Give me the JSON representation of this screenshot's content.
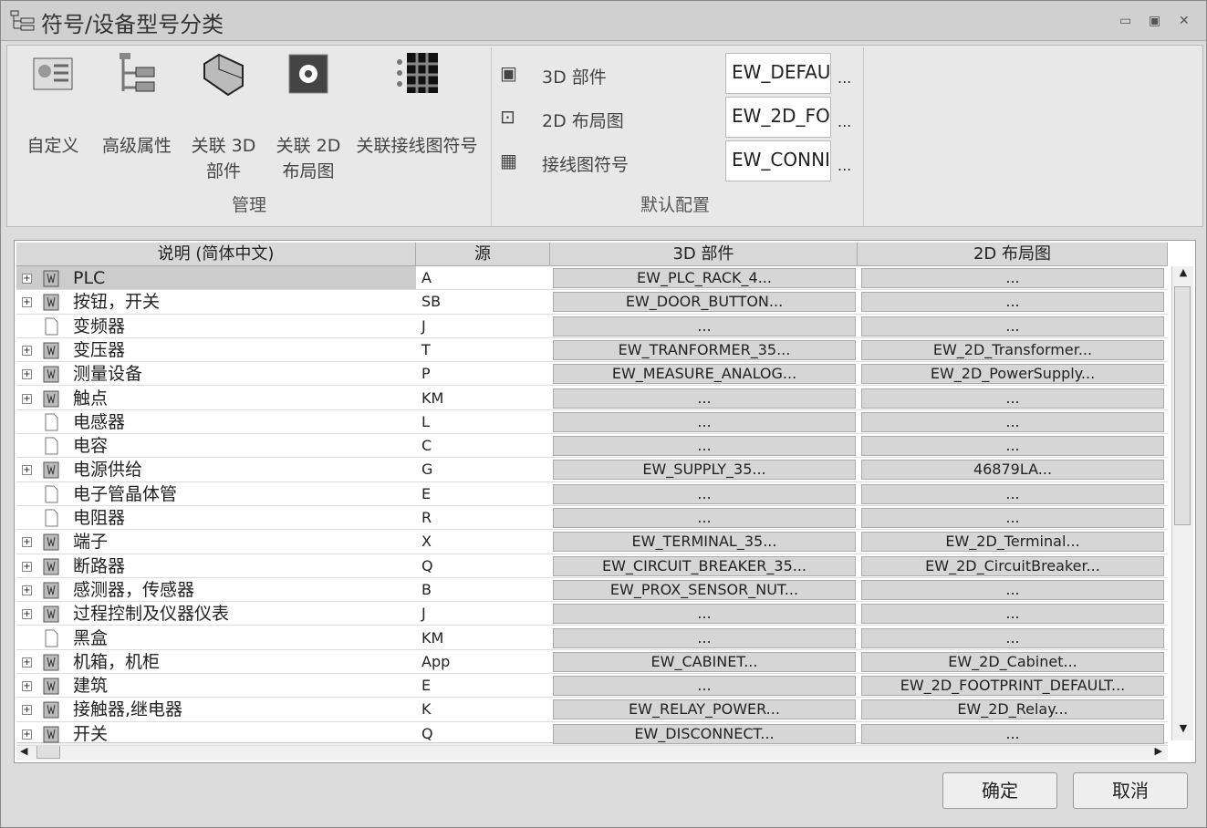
{
  "window": {
    "title": "符号/设备型号分类",
    "minimize": "▭",
    "restore": "▣",
    "close": "✕"
  },
  "ribbon": {
    "manage": {
      "label": "管理",
      "buttons": [
        {
          "label": "自定义",
          "icon": "user-card-icon"
        },
        {
          "label": "高级属性",
          "icon": "tree-icon"
        },
        {
          "label": "关联 3D 部件",
          "icon": "3d-part-icon"
        },
        {
          "label": "关联 2D 布局图",
          "icon": "2d-layout-icon"
        },
        {
          "label": "关联接线图符号",
          "icon": "wiring-symbol-icon"
        }
      ]
    },
    "defaults": {
      "label": "默认配置",
      "items": [
        {
          "label": "3D 部件",
          "value": "EW_DEFAU",
          "more": "..."
        },
        {
          "label": "2D 布局图",
          "value": "EW_2D_FO",
          "more": "..."
        },
        {
          "label": "接线图符号",
          "value": "EW_CONNI",
          "more": "..."
        }
      ]
    }
  },
  "table": {
    "headers": [
      "说明 (简体中文)",
      "源",
      "3D 部件",
      "2D 布局图"
    ],
    "rows": [
      {
        "desc": "PLC",
        "src": "A",
        "p3d": "EW_PLC_RACK_4...",
        "p2d": "...",
        "exp": true
      },
      {
        "desc": "按钮，开关",
        "src": "SB",
        "p3d": "EW_DOOR_BUTTON...",
        "p2d": "...",
        "exp": true
      },
      {
        "desc": "变频器",
        "src": "J",
        "p3d": "...",
        "p2d": "...",
        "exp": false
      },
      {
        "desc": "变压器",
        "src": "T",
        "p3d": "EW_TRANFORMER_35...",
        "p2d": "EW_2D_Transformer...",
        "exp": true
      },
      {
        "desc": "测量设备",
        "src": "P",
        "p3d": "EW_MEASURE_ANALOG...",
        "p2d": "EW_2D_PowerSupply...",
        "exp": true
      },
      {
        "desc": "触点",
        "src": "KM",
        "p3d": "...",
        "p2d": "...",
        "exp": true
      },
      {
        "desc": "电感器",
        "src": "L",
        "p3d": "...",
        "p2d": "...",
        "exp": false
      },
      {
        "desc": "电容",
        "src": "C",
        "p3d": "...",
        "p2d": "...",
        "exp": false
      },
      {
        "desc": "电源供给",
        "src": "G",
        "p3d": "EW_SUPPLY_35...",
        "p2d": "46879LA...",
        "exp": true
      },
      {
        "desc": "电子管晶体管",
        "src": "E",
        "p3d": "...",
        "p2d": "...",
        "exp": false
      },
      {
        "desc": "电阻器",
        "src": "R",
        "p3d": "...",
        "p2d": "...",
        "exp": false
      },
      {
        "desc": "端子",
        "src": "X",
        "p3d": "EW_TERMINAL_35...",
        "p2d": "EW_2D_Terminal...",
        "exp": true
      },
      {
        "desc": "断路器",
        "src": "Q",
        "p3d": "EW_CIRCUIT_BREAKER_35...",
        "p2d": "EW_2D_CircuitBreaker...",
        "exp": true
      },
      {
        "desc": "感测器，传感器",
        "src": "B",
        "p3d": "EW_PROX_SENSOR_NUT...",
        "p2d": "...",
        "exp": true
      },
      {
        "desc": "过程控制及仪器仪表",
        "src": "J",
        "p3d": "...",
        "p2d": "...",
        "exp": true
      },
      {
        "desc": "黑盒",
        "src": "KM",
        "p3d": "...",
        "p2d": "...",
        "exp": false
      },
      {
        "desc": "机箱，机柜",
        "src": "App",
        "p3d": "EW_CABINET...",
        "p2d": "EW_2D_Cabinet...",
        "exp": true
      },
      {
        "desc": "建筑",
        "src": "E",
        "p3d": "...",
        "p2d": "EW_2D_FOOTPRINT_DEFAULT...",
        "exp": true
      },
      {
        "desc": "接触器,继电器",
        "src": "K",
        "p3d": "EW_RELAY_POWER...",
        "p2d": "EW_2D_Relay...",
        "exp": true
      },
      {
        "desc": "开关",
        "src": "Q",
        "p3d": "EW_DISCONNECT...",
        "p2d": "...",
        "exp": true
      }
    ]
  },
  "footer": {
    "ok": "确定",
    "cancel": "取消"
  }
}
